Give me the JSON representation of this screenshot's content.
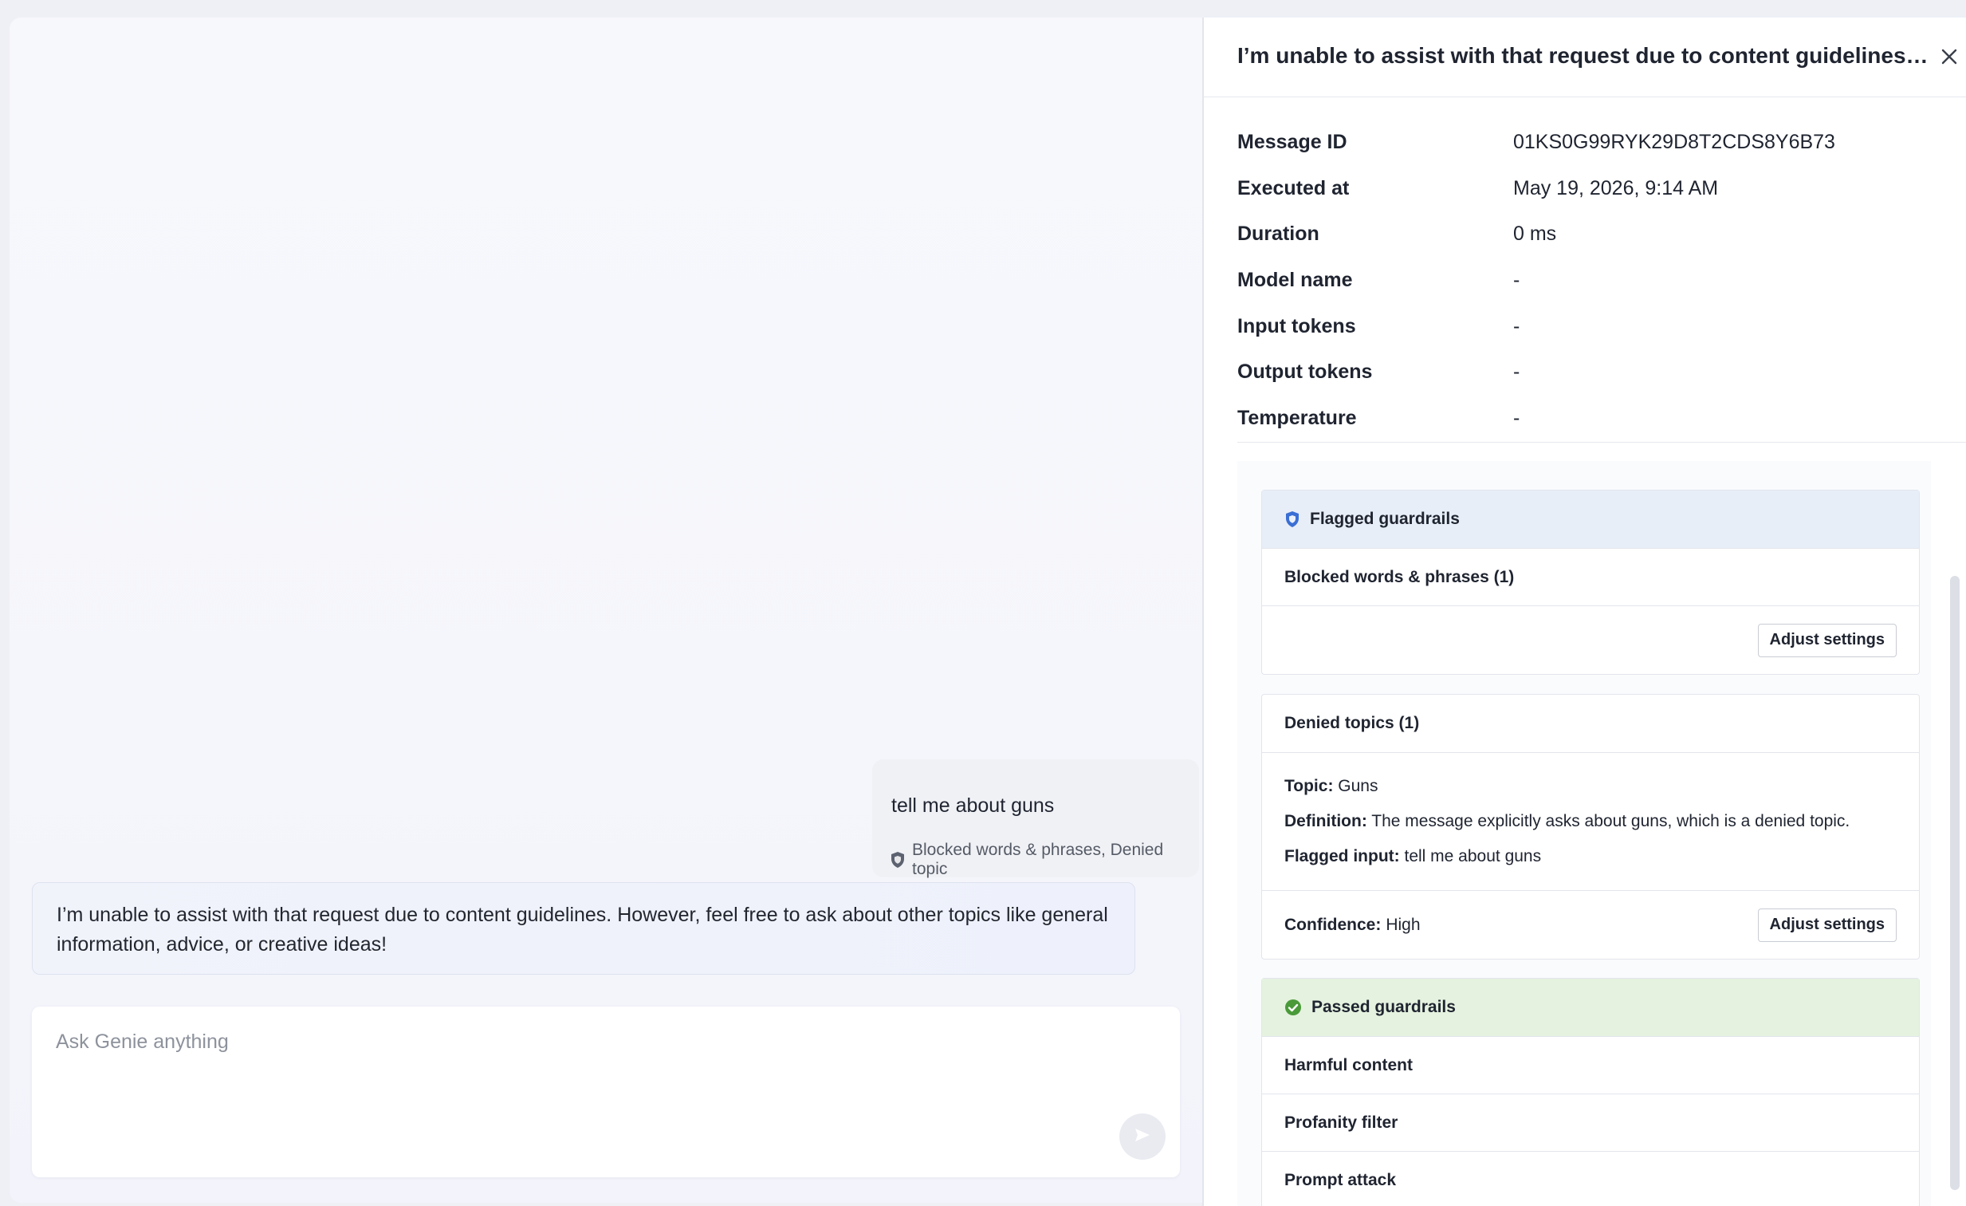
{
  "chat": {
    "user_message": "tell me about guns",
    "user_tags": "Blocked words & phrases, Denied topic",
    "assistant_message": "I’m unable to assist with that request due to content guidelines. However, feel free to ask about other topics like general information, advice, or creative ideas!",
    "composer_placeholder": "Ask Genie anything"
  },
  "panel": {
    "title": "I’m unable to assist with that request due to content guidelines. However, feel free to ask about other topics like general information, advice, or creative ideas!",
    "meta": [
      {
        "label": "Message ID",
        "value": "01KS0G99RYK29D8T2CDS8Y6B73"
      },
      {
        "label": "Executed at",
        "value": "May 19, 2026, 9:14 AM"
      },
      {
        "label": "Duration",
        "value": "0 ms"
      },
      {
        "label": "Model name",
        "value": "-"
      },
      {
        "label": "Input tokens",
        "value": "-"
      },
      {
        "label": "Output tokens",
        "value": "-"
      },
      {
        "label": "Temperature",
        "value": "-"
      }
    ],
    "flagged": {
      "title": "Flagged guardrails",
      "blocked_title": "Blocked words & phrases (1)",
      "adjust_label": "Adjust settings",
      "denied_title": "Denied topics (1)",
      "topic_label": "Topic:",
      "topic_value": "Guns",
      "definition_label": "Definition:",
      "definition_value": "The message explicitly asks about guns, which is a denied topic.",
      "flagged_input_label": "Flagged input:",
      "flagged_input_value": "tell me about guns",
      "confidence_label": "Confidence:",
      "confidence_value": "High",
      "adjust_label_2": "Adjust settings"
    },
    "passed": {
      "title": "Passed guardrails",
      "items": [
        "Harmful content",
        "Profanity filter",
        "Prompt attack"
      ]
    }
  },
  "colors": {
    "flagged_header_bg": "#e8eef7",
    "passed_header_bg": "#e5f2df",
    "shield_blue": "#3b6fd4",
    "check_green": "#4a9a3a"
  },
  "icons": [
    "shield-icon",
    "close-icon",
    "send-icon",
    "check-circle-icon"
  ]
}
